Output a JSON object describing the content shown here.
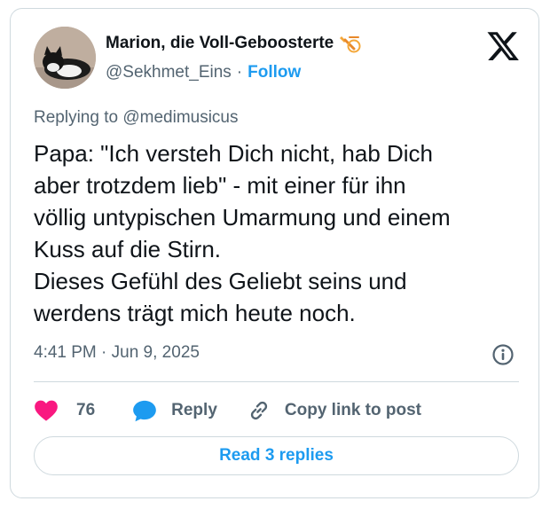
{
  "author": {
    "name": "Marion, die Voll-Geboosterte",
    "handle": "@Sekhmet_Eins",
    "separator": "·",
    "follow_label": "Follow"
  },
  "reply_context": {
    "prefix": "Replying to ",
    "mention": "@medimusicus"
  },
  "tweet": {
    "text": "Papa: \"Ich versteh Dich nicht, hab Dich\naber trotzdem lieb\" - mit einer für ihn\nvöllig untypischen Umarmung und einem\nKuss auf die Stirn.\nDieses Gefühl des Geliebt seins und\nwerdens trägt mich heute noch.",
    "timestamp": "4:41 PM · Jun 9, 2025"
  },
  "actions": {
    "like_count": "76",
    "reply_label": "Reply",
    "copy_label": "Copy link to post"
  },
  "read_replies_label": "Read 3 replies",
  "icons": {
    "brand": "x-logo-icon",
    "badge": "syringe-badge-icon",
    "info": "info-icon",
    "like": "heart-icon",
    "reply": "speech-bubble-icon",
    "copy": "link-icon"
  },
  "colors": {
    "accent": "#1d9bf0",
    "like": "#f91880",
    "muted": "#536471",
    "border": "#cfd9de"
  }
}
